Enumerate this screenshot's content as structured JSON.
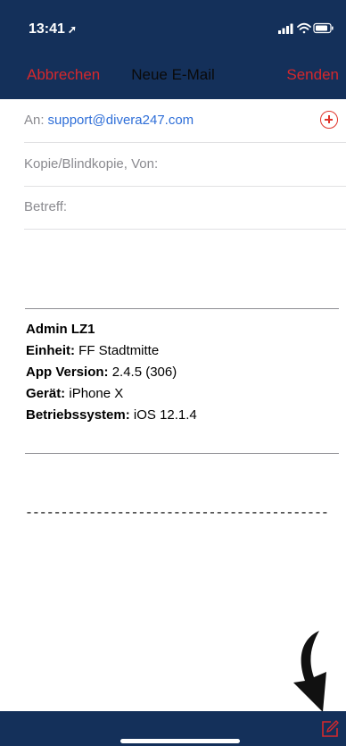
{
  "status_bar": {
    "time": "13:41",
    "location_glyph": "➚",
    "icons": [
      "signal-icon",
      "wifi-icon",
      "battery-icon"
    ]
  },
  "nav": {
    "cancel_label": "Abbrechen",
    "title": "Neue E-Mail",
    "send_label": "Senden"
  },
  "fields": {
    "to_label": "An:",
    "to_value": "support@divera247.com",
    "cc_label": "Kopie/Blindkopie, Von:",
    "subject_label": "Betreff:"
  },
  "body": {
    "name": "Admin LZ1",
    "lines": [
      {
        "label": "Einheit:",
        "value": "FF Stadtmitte"
      },
      {
        "label": "App Version:",
        "value": "2.4.5 (306)"
      },
      {
        "label": "Gerät:",
        "value": "iPhone X"
      },
      {
        "label": "Betriebssystem:",
        "value": "iOS 12.1.4"
      }
    ],
    "separator": "-------------------------------------------"
  },
  "colors": {
    "bar_background": "#14305a",
    "accent_red": "#d6282c",
    "link_blue": "#2f6fd8"
  }
}
